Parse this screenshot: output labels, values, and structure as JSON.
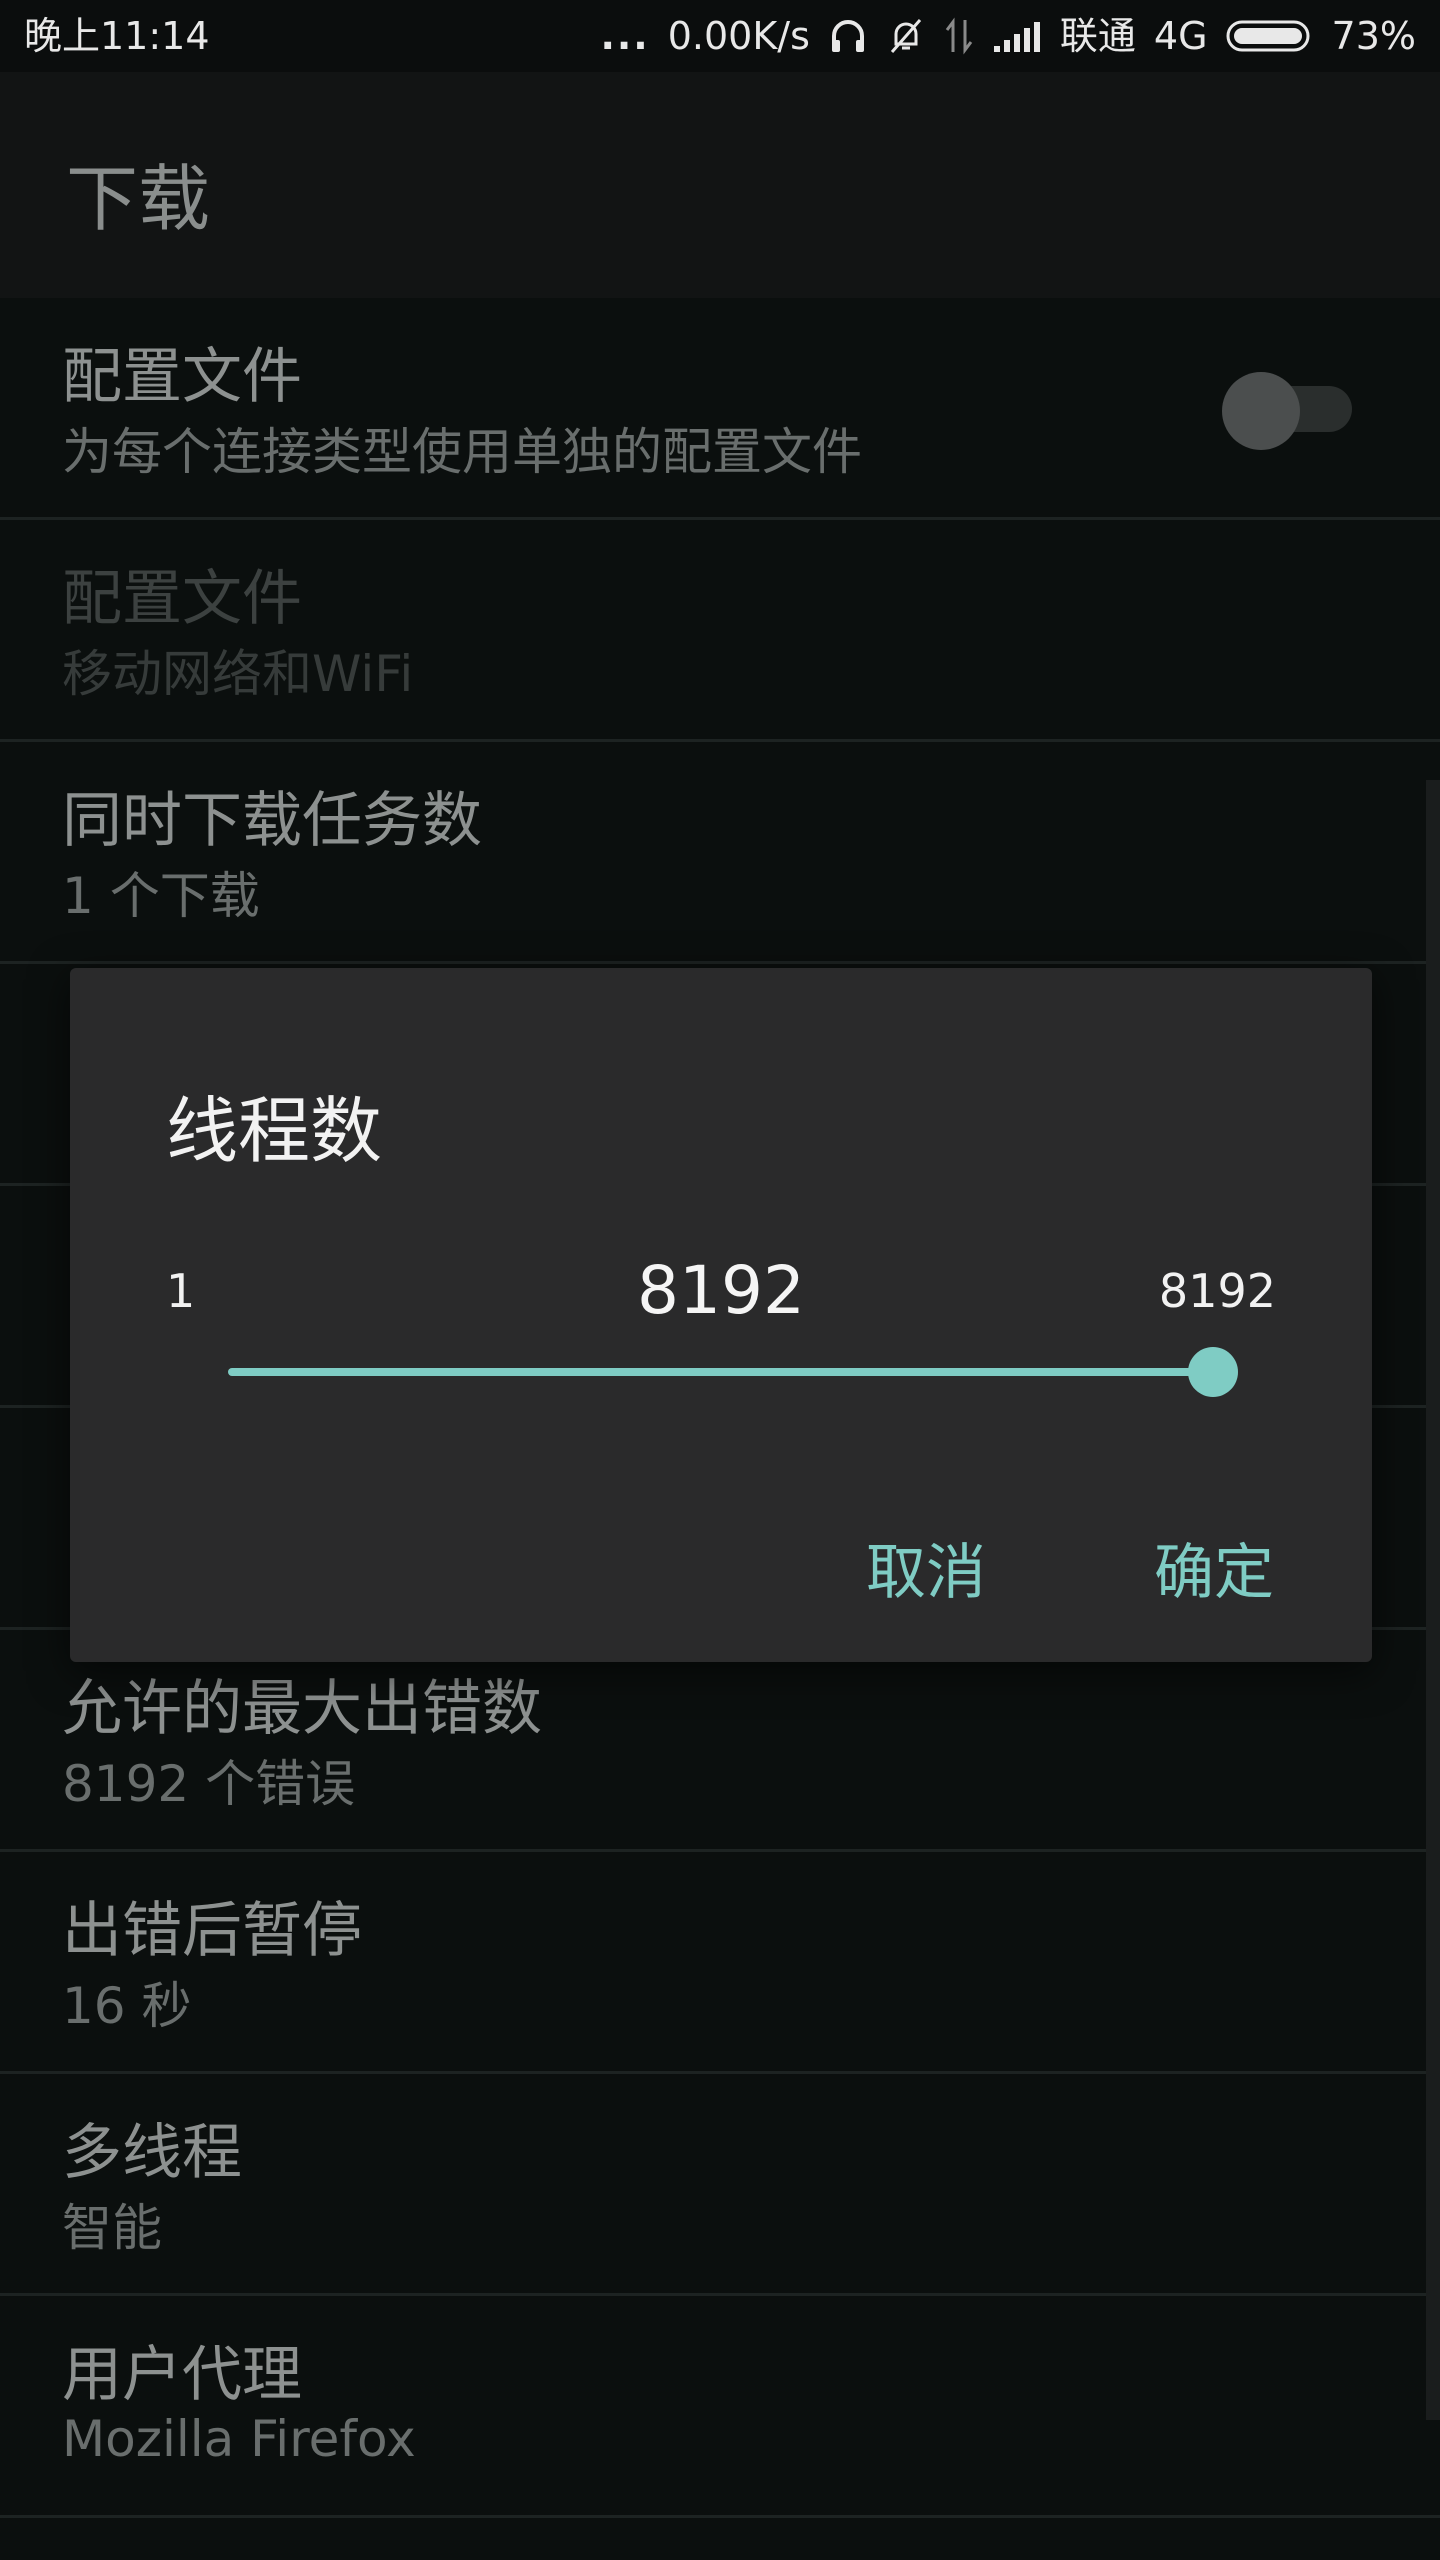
{
  "status_bar": {
    "time": "晚上11:14",
    "more": "...",
    "network_speed": "0.00K/s",
    "carrier": "联通",
    "network_type": "4G",
    "battery_percent": "73%",
    "battery_level": 0.73,
    "icons": [
      "headphones-icon",
      "bell-off-icon",
      "data-arrows-icon",
      "signal-icon",
      "battery-icon"
    ]
  },
  "toolbar": {
    "title": "下载"
  },
  "preferences": [
    {
      "title": "配置文件",
      "summary": "为每个连接类型使用单独的配置文件",
      "toggle": false
    },
    {
      "title": "配置文件",
      "summary": "移动网络和WiFi",
      "disabled": true
    },
    {
      "title": "同时下载任务数",
      "summary": "1 个下载"
    },
    {
      "title": "",
      "summary": ""
    },
    {
      "title": "",
      "summary": ""
    },
    {
      "title": "",
      "summary": ""
    },
    {
      "title": "允许的最大出错数",
      "summary": "8192 个错误"
    },
    {
      "title": "出错后暂停",
      "summary": "16 秒"
    },
    {
      "title": "多线程",
      "summary": "智能"
    },
    {
      "title": "用户代理",
      "summary": "Mozilla Firefox"
    }
  ],
  "dialog": {
    "title": "线程数",
    "min": "1",
    "max": "8192",
    "current": "8192",
    "position": 1.0,
    "cancel_label": "取消",
    "ok_label": "确定",
    "accent_color": "#7fccc4"
  }
}
